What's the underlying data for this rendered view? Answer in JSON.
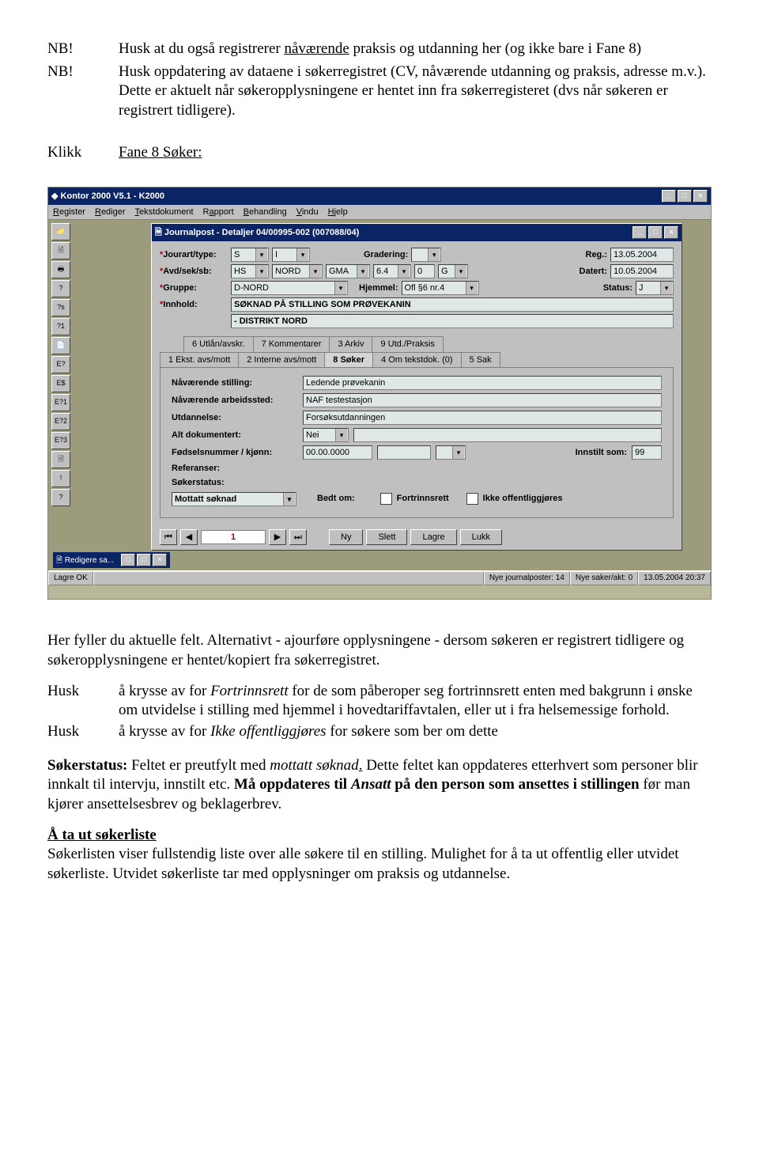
{
  "pre": {
    "nb1_label": "NB!",
    "nb1_text_a": "Husk at du også registrerer ",
    "nb1_text_u": "nåværende",
    "nb1_text_b": " praksis og utdanning her (og ikke bare i Fane 8)",
    "nb2_label": "NB!",
    "nb2_text": "Husk oppdatering av dataene i søkerregistret (CV, nåværende utdanning og praksis, adresse m.v.). Dette er aktuelt når søkeropplysningene er hentet inn fra søkerregisteret (dvs når søkeren er registrert tidligere).",
    "klikk_label": "Klikk",
    "klikk_link": "Fane 8 Søker:"
  },
  "app": {
    "title": "Kontor 2000 V5.1 - K2000",
    "menu": [
      "Register",
      "Rediger",
      "Tekstdokument",
      "Rapport",
      "Behandling",
      "Vindu",
      "Hjelp"
    ],
    "toolbar": [
      "📁",
      "🗎",
      "🖶",
      "?",
      "?s",
      "?1",
      "📄",
      "E?",
      "E$",
      "E?1",
      "E?2",
      "E?3",
      "🗎",
      "!",
      "?"
    ],
    "inner_title": "Journalpost - Detaljer 04/00995-002 (007088/04)",
    "fields": {
      "jourart_label": "Jourart/type:",
      "jourart_v1": "S",
      "jourart_v2": "I",
      "gradering_label": "Gradering:",
      "reg_label": "Reg.:",
      "reg_val": "13.05.2004",
      "avd_label": "Avd/sek/sb:",
      "avd_v1": "HS",
      "avd_v2": "NORD",
      "avd_v3": "GMA",
      "avd_n1": "6.4",
      "avd_n2": "0",
      "avd_n3": "G",
      "datert_label": "Datert:",
      "datert_val": "10.05.2004",
      "gruppe_label": "Gruppe:",
      "gruppe_val": "D-NORD",
      "hjemmel_label": "Hjemmel:",
      "hjemmel_val": "Ofl §6 nr.4",
      "status_label": "Status:",
      "status_val": "J",
      "innhold_label": "Innhold:",
      "innhold_v1": "SØKNAD PÅ STILLING SOM PRØVEKANIN",
      "innhold_v2": "- DISTRIKT NORD"
    },
    "tabs_top": [
      "6 Utlån/avskr.",
      "7 Kommentarer",
      "3 Arkiv",
      "9 Utd./Praksis"
    ],
    "tabs_bot": [
      "1 Ekst. avs/mott",
      "2 Interne avs/mott",
      "8 Søker",
      "4 Om tekstdok. (0)",
      "5 Sak"
    ],
    "soker": {
      "stilling_lbl": "Nåværende stilling:",
      "stilling_val": "Ledende prøvekanin",
      "arbeid_lbl": "Nåværende arbeidssted:",
      "arbeid_val": "NAF testestasjon",
      "utd_lbl": "Utdannelse:",
      "utd_val": "Forsøksutdanningen",
      "alt_lbl": "Alt dokumentert:",
      "alt_val": "Nei",
      "fnr_lbl": "Fødselsnummer / kjønn:",
      "fnr_val": "00.00.0000",
      "innstilt_lbl": "Innstilt som:",
      "innstilt_val": "99",
      "ref_lbl": "Referanser:",
      "status_lbl": "Søkerstatus:",
      "status_val": "Mottatt søknad",
      "bedt_lbl": "Bedt om:",
      "fortrinn_lbl": "Fortrinnsrett",
      "ikkeoff_lbl": "Ikke offentliggjøres"
    },
    "nav": {
      "counter": "1",
      "ny": "Ny",
      "slett": "Slett",
      "lagre": "Lagre",
      "lukk": "Lukk"
    },
    "minwin": "Redigere sa...",
    "status": {
      "left": "Lagre OK",
      "mid1": "Nye journalposter: 14",
      "mid2": "Nye saker/akt: 0",
      "right": "13.05.2004 20:37"
    }
  },
  "post": {
    "p1": "Her fyller du aktuelle felt. Alternativt - ajourføre opplysningene - dersom søkeren er registrert tidligere og søkeropplysningene er hentet/kopiert fra søkerregistret.",
    "husk1_lbl": "Husk",
    "husk1_a": "å krysse av for ",
    "husk1_i": "Fortrinnsrett",
    "husk1_b": " for de som påberoper seg fortrinnsrett enten med bakgrunn i ønske om utvidelse i stilling med hjemmel i hovedtariffavtalen, eller ut i fra helsemessige forhold.",
    "husk2_lbl": "Husk",
    "husk2_a": "å krysse av for ",
    "husk2_i": "Ikke offentliggjøres",
    "husk2_b": "  for søkere som ber om dette",
    "p3_a": "Søkerstatus:",
    "p3_b": " Feltet er preutfylt med ",
    "p3_i1": "mottatt søknad",
    "p3_dot": ".",
    "p3_c": " Dette feltet kan oppdateres etterhvert som personer blir innkalt til intervju, innstilt etc. ",
    "p3_d": "Må oppdateres til ",
    "p3_i2": "Ansatt",
    "p3_e": " på den person som ansettes i stillingen",
    "p3_f": " før man kjører ansettelsesbrev og beklagerbrev.",
    "p4_h": "Å ta ut søkerliste",
    "p4_t": "Søkerlisten viser fullstendig liste over alle søkere til en stilling. Mulighet for å ta ut offentlig eller utvidet søkerliste. Utvidet søkerliste tar med opplysninger om praksis og utdannelse."
  }
}
